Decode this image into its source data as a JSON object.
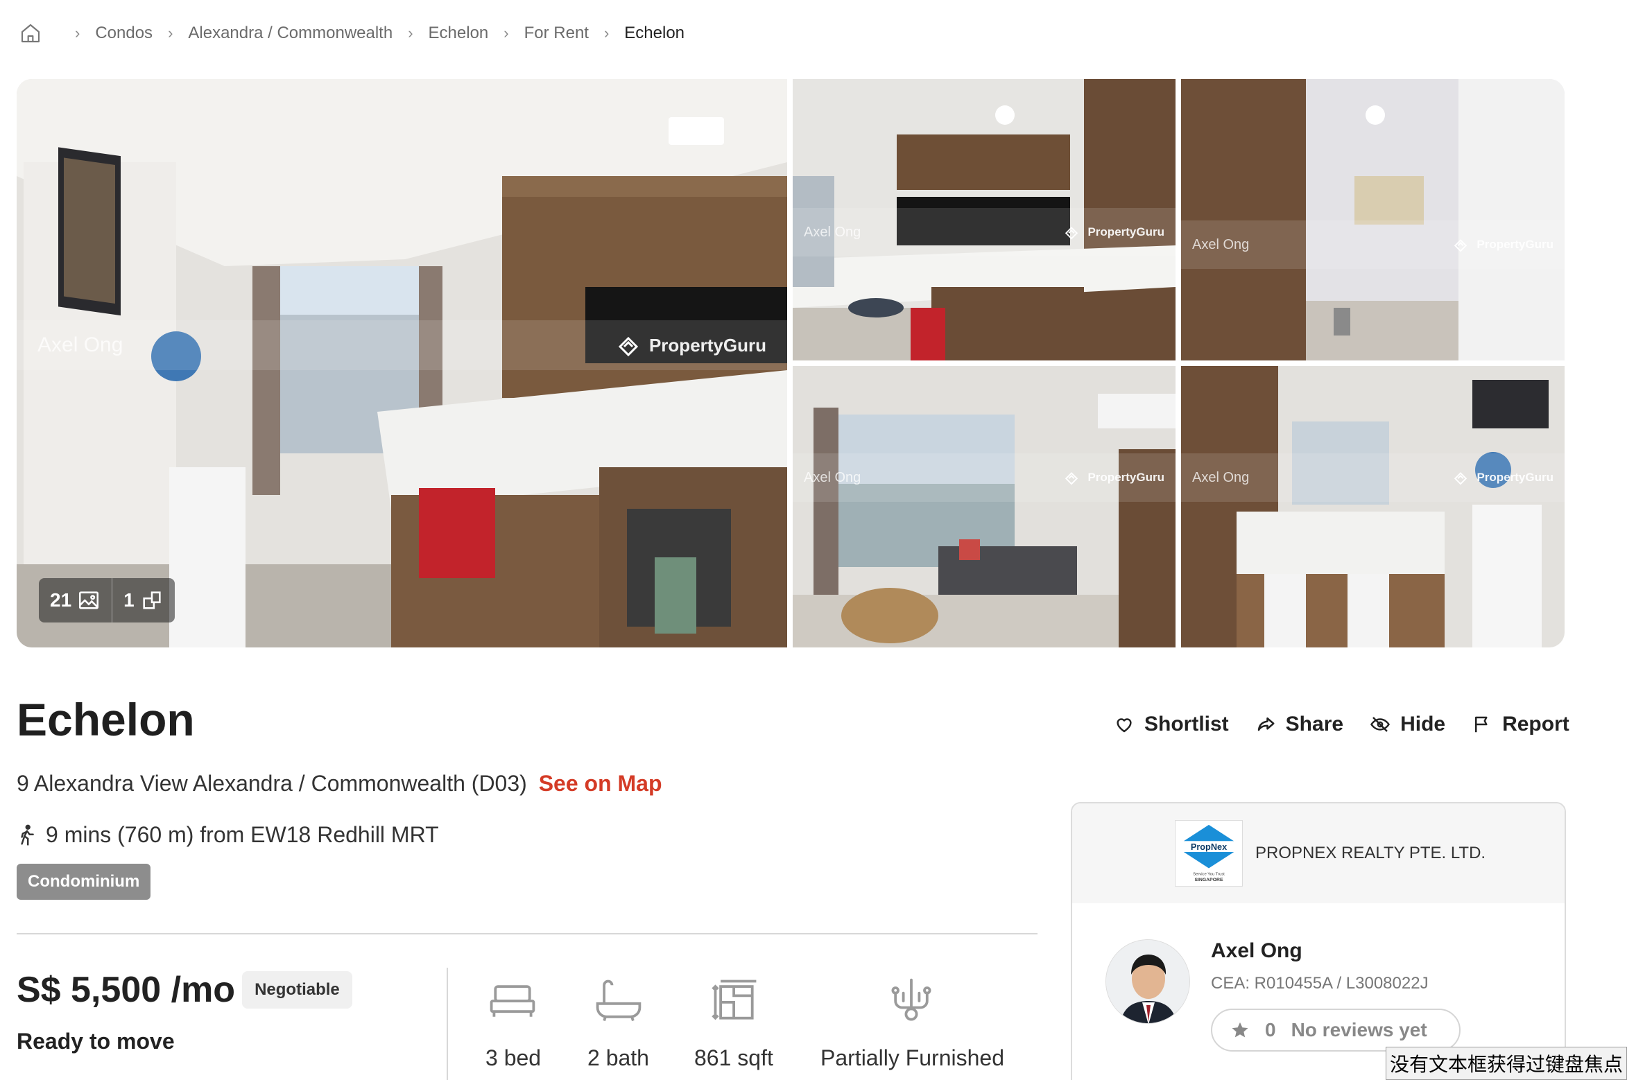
{
  "breadcrumb": {
    "items": [
      "Condos",
      "Alexandra / Commonwealth",
      "Echelon",
      "For Rent"
    ],
    "current": "Echelon"
  },
  "gallery": {
    "watermark_agent": "Axel Ong",
    "watermark_brand": "PropertyGuru",
    "photo_count": "21",
    "floorplan_count": "1"
  },
  "listing": {
    "title": "Echelon",
    "address": "9 Alexandra View Alexandra / Commonwealth (D03)",
    "see_map": "See on Map",
    "mrt": "9 mins (760 m) from EW18 Redhill MRT",
    "property_type": "Condominium",
    "price": "S$ 5,500 /mo",
    "negotiable": "Negotiable",
    "availability": "Ready to move",
    "facts": [
      {
        "icon": "bed-icon",
        "label": "3 bed"
      },
      {
        "icon": "bath-icon",
        "label": "2 bath"
      },
      {
        "icon": "area-icon",
        "label": "861 sqft"
      },
      {
        "icon": "furnishing-icon",
        "label": "Partially Furnished"
      }
    ]
  },
  "actions": {
    "shortlist": "Shortlist",
    "share": "Share",
    "hide": "Hide",
    "report": "Report"
  },
  "agent": {
    "agency_logo_text": "PropNex",
    "agency_logo_tagline": "Service You Trust",
    "agency_logo_country": "SINGAPORE",
    "agency_name": "PROPNEX REALTY PTE. LTD.",
    "name": "Axel Ong",
    "cea": "CEA: R010455A / L3008022J",
    "review_count": "0",
    "review_text": "No reviews yet"
  },
  "ime": {
    "message": "没有文本框获得过键盘焦点"
  },
  "colors": {
    "accent_red": "#d43b26",
    "badge_grey": "#8d8d8d",
    "propnex_blue": "#1a8fd8"
  }
}
